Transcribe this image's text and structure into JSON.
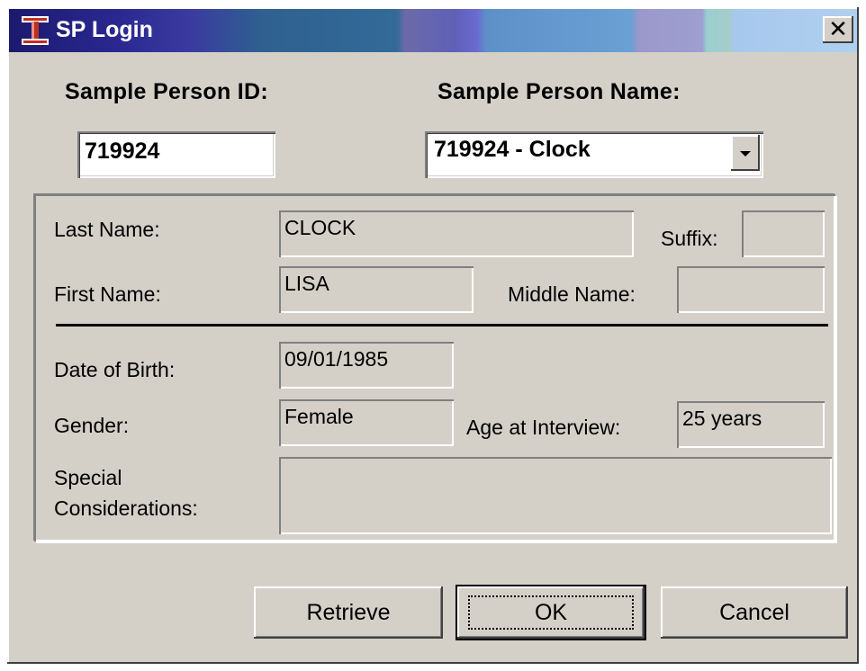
{
  "window": {
    "title": "SP Login",
    "close_glyph": "✕"
  },
  "header": {
    "id_label": "Sample Person ID:",
    "name_label": "Sample Person Name:"
  },
  "inputs": {
    "sample_person_id": "719924",
    "sample_person_name_selected": "719924 - Clock"
  },
  "details": {
    "last_name_label": "Last Name:",
    "last_name": "CLOCK",
    "suffix_label": "Suffix:",
    "suffix": "",
    "first_name_label": "First Name:",
    "first_name": "LISA",
    "middle_name_label": "Middle Name:",
    "middle_name": "",
    "dob_label": "Date of Birth:",
    "dob": "09/01/1985",
    "gender_label": "Gender:",
    "gender": "Female",
    "age_label": "Age at Interview:",
    "age": "25 years",
    "special_label_line1": "Special",
    "special_label_line2": "Considerations:",
    "special": ""
  },
  "buttons": {
    "retrieve": "Retrieve",
    "ok": "OK",
    "cancel": "Cancel"
  },
  "icons": {
    "app": "rail-i-beam-icon",
    "close": "close-icon",
    "dropdown": "chevron-down-icon"
  }
}
